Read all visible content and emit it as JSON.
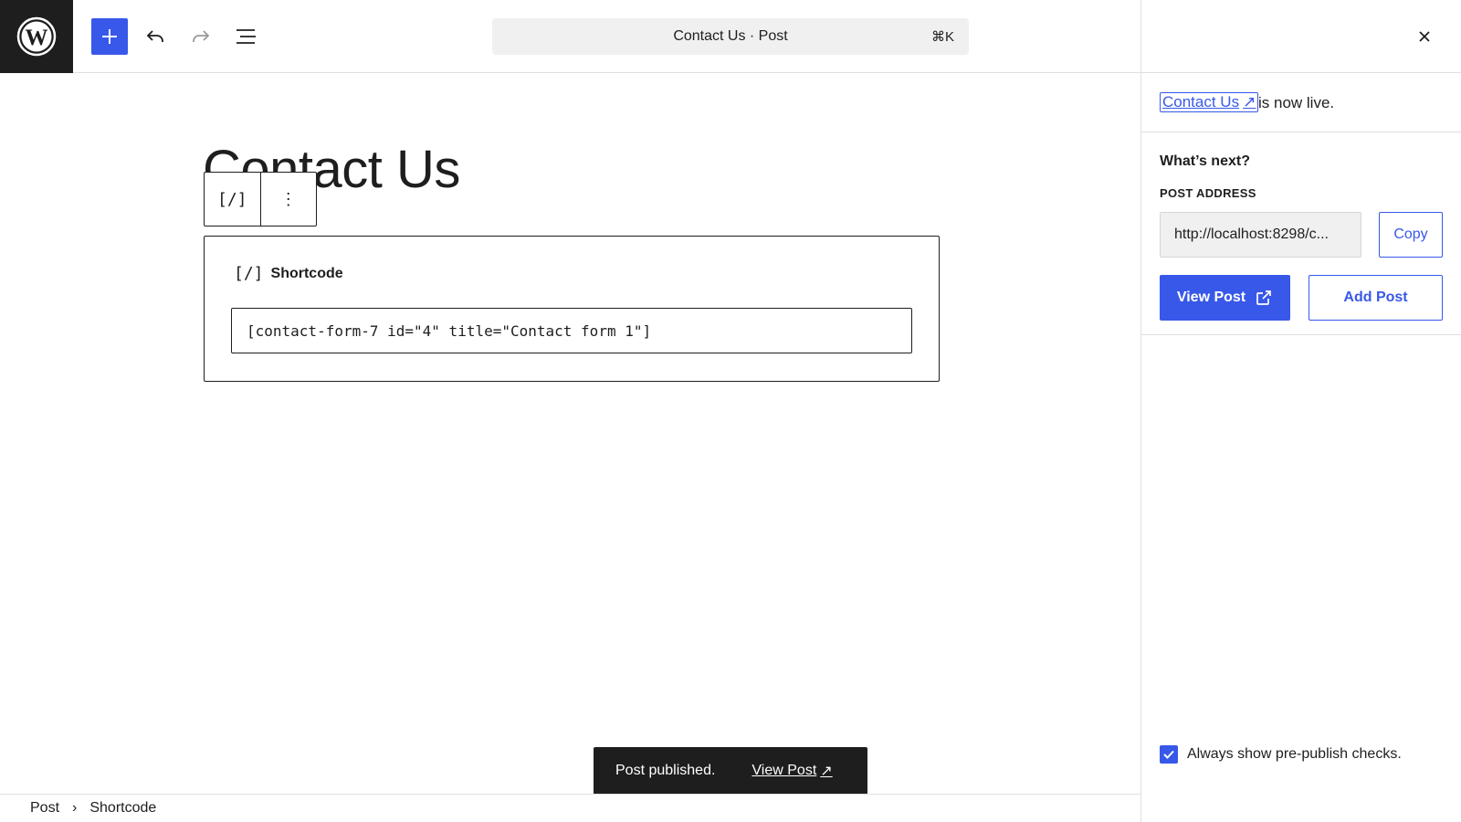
{
  "toolbar": {
    "command_bar_text": "Contact Us · Post",
    "command_shortcut": "⌘K"
  },
  "editor": {
    "post_title": "Contact Us",
    "block_toolbar": {
      "block_icon": "[/]",
      "options_icon": "⋮"
    },
    "shortcode_block": {
      "icon": "[/]",
      "label": "Shortcode",
      "value": "[contact-form-7 id=\"4\" title=\"Contact form 1\"]"
    }
  },
  "snackbar": {
    "message": "Post published.",
    "link_label": "View Post",
    "link_icon": "↗"
  },
  "footer": {
    "breadcrumb": [
      "Post",
      "Shortcode"
    ],
    "separator": "›"
  },
  "sidebar": {
    "live_link": "Contact Us",
    "live_link_icon": "↗",
    "live_text": "is now live.",
    "whats_next": "What’s next?",
    "post_address_label": "POST ADDRESS",
    "post_address_value": "http://localhost:8298/c...",
    "copy_label": "Copy",
    "view_post_label": "View Post",
    "add_post_label": "Add Post",
    "prepublish_label": "Always show pre-publish checks.",
    "prepublish_checked": true
  },
  "colors": {
    "accent": "#3858e9",
    "dark": "#1e1e1e",
    "border": "#e0e0e0"
  }
}
